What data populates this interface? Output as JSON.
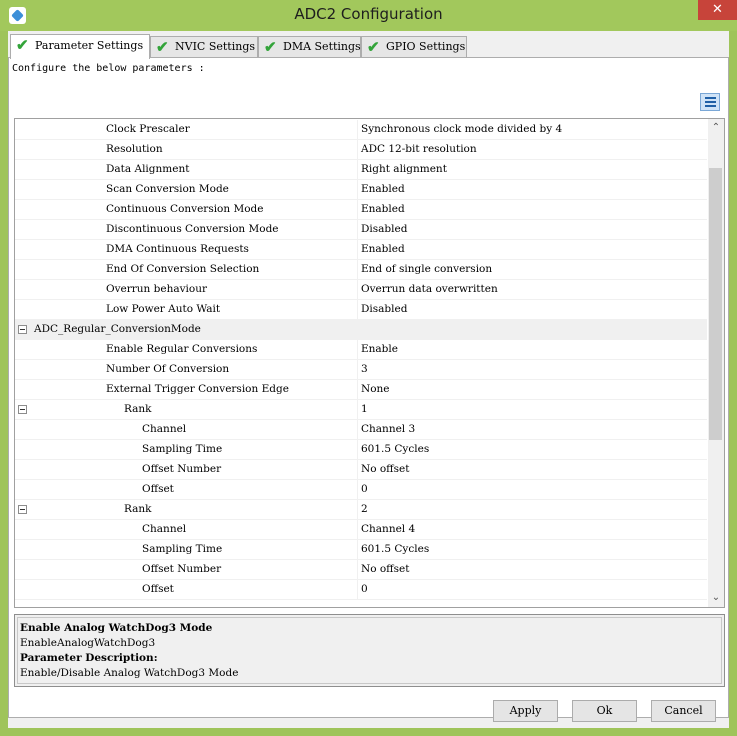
{
  "window": {
    "title": "ADC2 Configuration",
    "close_glyph": "✕",
    "icon": "app-icon"
  },
  "tabs": [
    {
      "label": "Parameter Settings",
      "active": true
    },
    {
      "label": "NVIC Settings",
      "active": false
    },
    {
      "label": "DMA Settings",
      "active": false
    },
    {
      "label": "GPIO Settings",
      "active": false
    }
  ],
  "panel": {
    "description": "Configure the below parameters :"
  },
  "grid": {
    "rows": [
      {
        "name": "Clock Prescaler",
        "value": "Synchronous clock mode divided by 4"
      },
      {
        "name": "Resolution",
        "value": "ADC 12-bit resolution"
      },
      {
        "name": "Data Alignment",
        "value": "Right alignment"
      },
      {
        "name": "Scan Conversion Mode",
        "value": "Enabled"
      },
      {
        "name": "Continuous Conversion Mode",
        "value": "Enabled"
      },
      {
        "name": "Discontinuous Conversion Mode",
        "value": "Disabled"
      },
      {
        "name": "DMA Continuous Requests",
        "value": "Enabled"
      },
      {
        "name": "End Of Conversion Selection",
        "value": "End of single conversion"
      },
      {
        "name": "Overrun behaviour",
        "value": "Overrun data overwritten"
      },
      {
        "name": "Low Power Auto Wait",
        "value": "Disabled"
      },
      {
        "name": "ADC_Regular_ConversionMode",
        "value": ""
      },
      {
        "name": "Enable Regular Conversions",
        "value": "Enable"
      },
      {
        "name": "Number Of Conversion",
        "value": "3"
      },
      {
        "name": "External Trigger Conversion Edge",
        "value": "None"
      },
      {
        "name": "Rank",
        "value": "1"
      },
      {
        "name": "Channel",
        "value": "Channel 3"
      },
      {
        "name": "Sampling Time",
        "value": "601.5 Cycles"
      },
      {
        "name": "Offset Number",
        "value": "No offset"
      },
      {
        "name": "Offset",
        "value": "0"
      },
      {
        "name": "Rank",
        "value": "2"
      },
      {
        "name": "Channel",
        "value": "Channel 4"
      },
      {
        "name": "Sampling Time",
        "value": "601.5 Cycles"
      },
      {
        "name": "Offset Number",
        "value": "No offset"
      },
      {
        "name": "Offset",
        "value": "0"
      }
    ]
  },
  "info": {
    "param_title": "Enable Analog WatchDog3 Mode",
    "param_id": "EnableAnalogWatchDog3",
    "desc_heading": "Parameter Description:",
    "desc_text": "Enable/Disable Analog WatchDog3 Mode"
  },
  "buttons": {
    "apply": "Apply",
    "ok": "Ok",
    "cancel": "Cancel"
  }
}
